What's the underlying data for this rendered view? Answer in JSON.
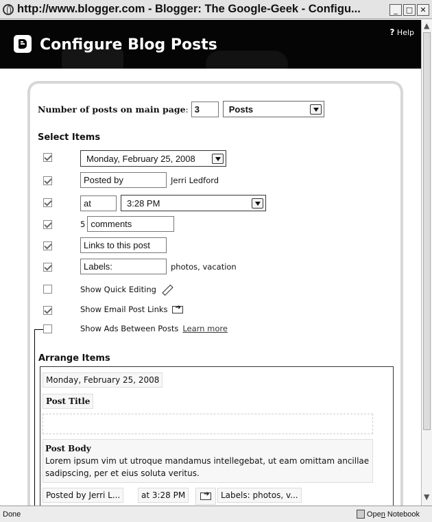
{
  "window": {
    "title": "http://www.blogger.com - Blogger: The Google-Geek - Configu...",
    "buttons": [
      "_",
      "□",
      "✕"
    ]
  },
  "header": {
    "title": "Configure Blog Posts",
    "help_mark": "?",
    "help_label": "Help"
  },
  "posts_count": {
    "label": "Number of posts on main page",
    "colon": ":",
    "value": "3",
    "unit": "Posts"
  },
  "select_items": {
    "heading": "Select Items",
    "date_format": "Monday, February 25, 2008",
    "posted_by_field": "Posted by",
    "author": "Jerri Ledford",
    "at_field": "at",
    "time_format": "3:28 PM",
    "comments_count": "5",
    "comments_field": "comments",
    "links_field": "Links to this post",
    "labels_field": "Labels:",
    "labels_value": "photos, vacation",
    "quick_editing": "Show Quick Editing",
    "email_links": "Show Email Post Links",
    "ads_between": "Show Ads Between Posts",
    "learn_more": "Learn more",
    "checked": [
      true,
      true,
      true,
      true,
      true,
      true,
      false,
      true,
      false
    ]
  },
  "arrange_items": {
    "heading": "Arrange Items",
    "date": "Monday, February 25, 2008",
    "post_title": "Post Title",
    "post_body_title": "Post Body",
    "post_body_text": "Lorem ipsum vim ut utroque mandamus intellegebat, ut eam omittam ancillae sadipscing, per et eius soluta veritus.",
    "posted_by": "Posted by Jerri L...",
    "at_time": "at 3:28 PM",
    "labels": "Labels: photos, v..."
  },
  "status": {
    "text": "Done",
    "notebook_pre": "Ope",
    "notebook_u": "n",
    "notebook_post": " Notebook"
  }
}
